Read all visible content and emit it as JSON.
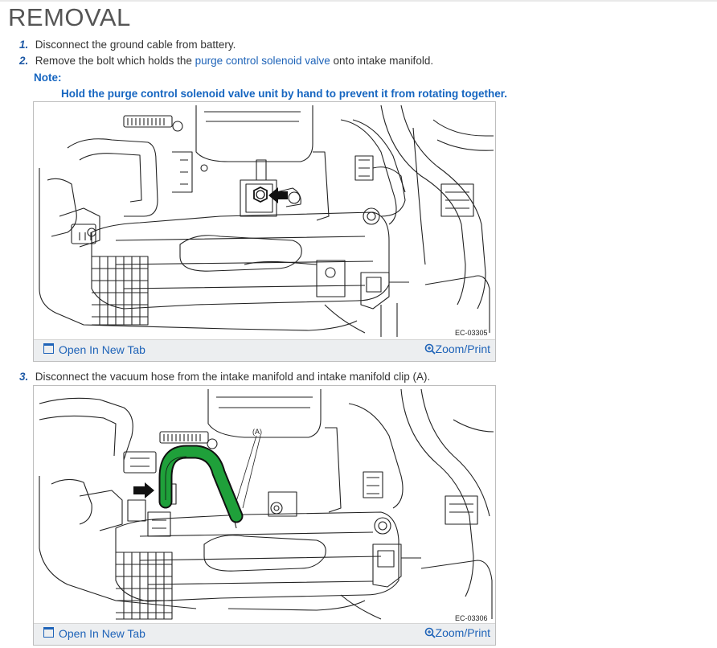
{
  "page": {
    "title": "REMOVAL"
  },
  "steps": [
    {
      "num": "1.",
      "text": "Disconnect the ground cable from battery."
    },
    {
      "num": "2.",
      "text_before": "Remove the bolt which holds the ",
      "link": "purge control solenoid valve",
      "text_after": " onto intake manifold."
    },
    {
      "num": "3.",
      "text": "Disconnect the vacuum hose from the intake manifold and intake manifold clip (A)."
    }
  ],
  "note": {
    "label": "Note:",
    "text": "Hold the purge control solenoid valve unit by hand to prevent it from rotating together."
  },
  "figures": [
    {
      "code": "EC-03305",
      "open_label": "Open In New Tab",
      "zoom_label": "Zoom/Print"
    },
    {
      "code": "EC-03306",
      "callout": "(A)",
      "open_label": "Open In New Tab",
      "zoom_label": "Zoom/Print"
    }
  ],
  "colors": {
    "link": "#1e63b8",
    "note": "#1565c0",
    "hose_highlight": "#1fa03a",
    "step_num": "#1f5aa6"
  },
  "icons": {
    "open_tab": "open-new-tab-icon",
    "zoom": "magnifier-plus-icon"
  }
}
